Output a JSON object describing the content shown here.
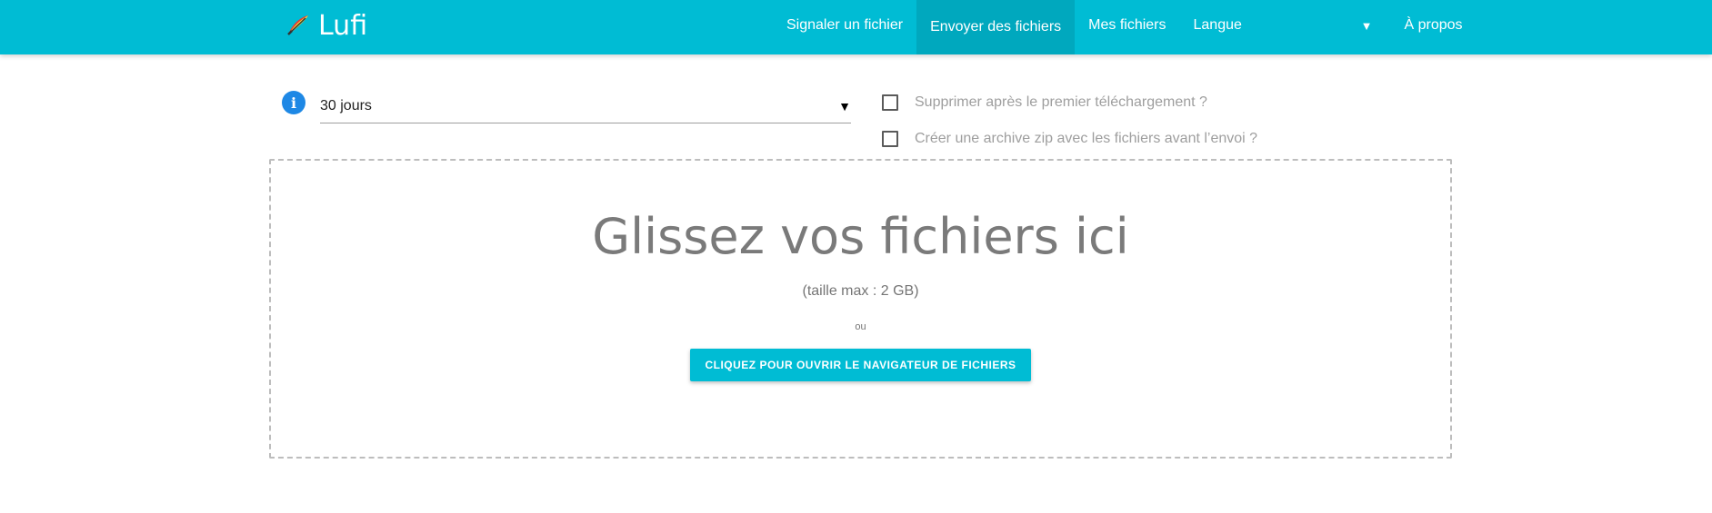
{
  "navbar": {
    "brand": "Lufi",
    "brand_logo_icon": "lufi-logo-icon",
    "items": [
      {
        "label": "Signaler un fichier",
        "active": false
      },
      {
        "label": "Envoyer des fichiers",
        "active": true
      },
      {
        "label": "Mes fichiers",
        "active": false
      }
    ],
    "language": {
      "label": "Langue",
      "caret": "▼"
    },
    "about": "À propos"
  },
  "options": {
    "info_icon": "info-icon",
    "info_glyph": "i",
    "delay": {
      "value": "30 jours",
      "caret": "▼"
    },
    "delete_after_first_download": {
      "label": "Supprimer après le premier téléchargement ?",
      "checked": false
    },
    "create_zip": {
      "label": "Créer une archive zip avec les fichiers avant l’envoi ?",
      "checked": false
    }
  },
  "dropzone": {
    "title": "Glissez vos fichiers ici",
    "max_size": "(taille max : 2 GB)",
    "or": "ou",
    "button": "Cliquez pour ouvrir le navigateur de fichiers"
  },
  "colors": {
    "primary": "#00bcd4",
    "info": "#1e88e5",
    "muted_text": "#9e9e9e"
  }
}
